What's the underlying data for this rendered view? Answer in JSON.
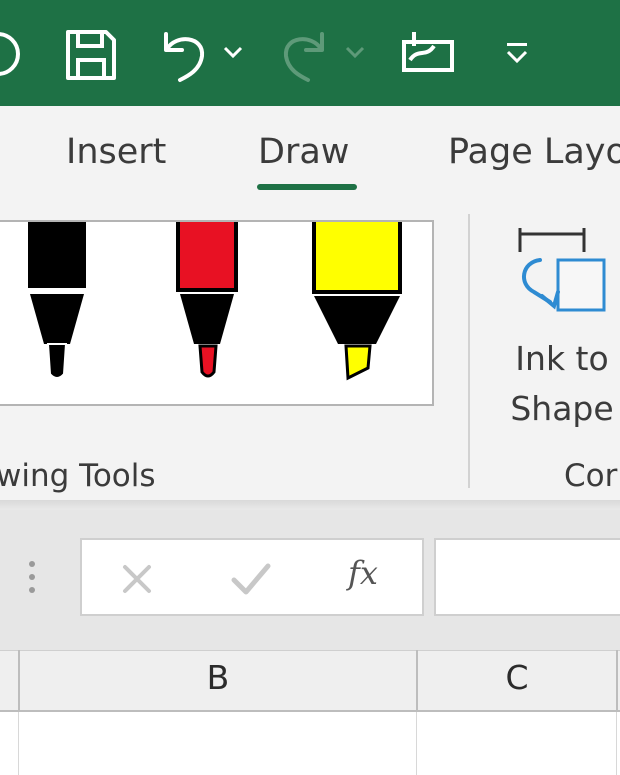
{
  "quick_access": {
    "icons": [
      "circle-icon",
      "save-icon",
      "undo-icon",
      "dropdown-icon",
      "redo-icon",
      "dropdown-icon",
      "touch-mode-icon",
      "customize-icon"
    ]
  },
  "ribbon": {
    "tabs": [
      {
        "label": "Insert",
        "active": false
      },
      {
        "label": "Draw",
        "active": true
      },
      {
        "label": "Page Layo",
        "active": false
      }
    ],
    "groups": {
      "drawing_tools_label": "wing Tools",
      "convert_label": "Cor"
    },
    "pens": [
      {
        "name": "black pen",
        "color": "#000000"
      },
      {
        "name": "red pen",
        "color": "#e81123"
      },
      {
        "name": "yellow highlighter",
        "color": "#ffff00"
      }
    ],
    "ink_to_shape": {
      "line1": "Ink to",
      "line2": "Shape"
    }
  },
  "formula_bar": {
    "cancel_icon": "cross-icon",
    "enter_icon": "check-icon",
    "function_label": "fx",
    "value": ""
  },
  "columns": [
    "B",
    "C"
  ],
  "colors": {
    "brand": "#1e7145",
    "ribbon_bg": "#f3f3f3",
    "ink_accent": "#2e8bd2"
  }
}
